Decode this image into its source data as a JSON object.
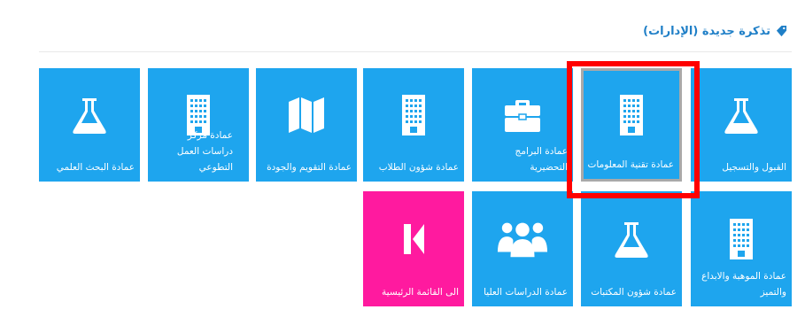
{
  "header": {
    "title": "تذكرة جديدة (الإدارات)",
    "icon": "tag-icon"
  },
  "tiles": [
    {
      "label": "القبول والتسجيل",
      "icon": "flask-icon"
    },
    {
      "label": "عمادة تقنية المعلومات",
      "icon": "building-icon",
      "selected": true
    },
    {
      "label": "عمادة البرامج التحضيرية",
      "icon": "briefcase-icon"
    },
    {
      "label": "عمادة شؤون الطلاب",
      "icon": "building-icon"
    },
    {
      "label": "عمادة التقويم والجودة",
      "icon": "map-icon"
    },
    {
      "label": "عمادة مركز دراسات العمل التطوعي",
      "icon": "building-icon"
    },
    {
      "label": "عمادة البحث العلمي",
      "icon": "flask-icon"
    },
    {
      "label": "عمادة الموهبة والابداع والتميز",
      "icon": "building-icon"
    },
    {
      "label": "عمادة شؤون المكتبات",
      "icon": "flask-icon"
    },
    {
      "label": "عمادة الدراسات العليا",
      "icon": "users-icon"
    },
    {
      "label": "الى القائمة الرئيسية",
      "icon": "back-icon"
    }
  ],
  "colors": {
    "tile": "#1ea5ee",
    "home_tile": "#ff1a9f",
    "header": "#1f7fc7",
    "highlight": "#ff0000"
  }
}
